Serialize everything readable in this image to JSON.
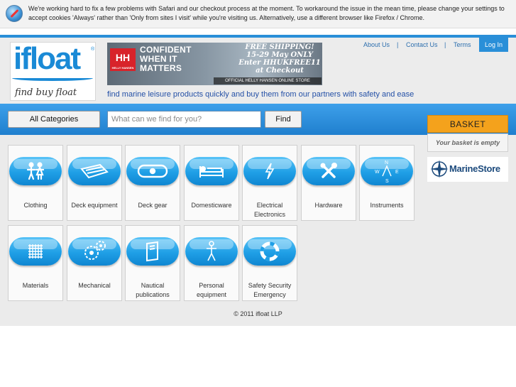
{
  "notice": {
    "text": "We're working hard to fix a few problems with Safari and our checkout process at the moment. To workaround the issue in the mean time, please change your settings to accept cookies 'Always' rather than 'Only from sites I visit' while you're visiting us. Alternatively, use a different browser like Firefox / Chrome.",
    "icon": "safari-compass-icon"
  },
  "brand": {
    "logo_text": "ifloat",
    "logo_registered": "®",
    "logo_tagline": "find buy float",
    "tagline": "find marine leisure products quickly and buy them from our partners with safety and ease",
    "accent": "#2a8fd8"
  },
  "banner": {
    "badge": "HH",
    "badge_sub": "HELLY HANSEN",
    "headline": "CONFIDENT WHEN IT MATTERS",
    "promo": "FREE SHIPPING! 15-29 May ONLY Enter HHUKFREE11 at Checkout",
    "footer": "OFFICIAL HELLY HANSEN ONLINE STORE"
  },
  "nav": {
    "about": "About Us",
    "contact": "Contact Us",
    "terms": "Terms",
    "separator": "|",
    "login": "Log In"
  },
  "search": {
    "category_label": "All Categories",
    "placeholder": "What can we find for you?",
    "find_label": "Find"
  },
  "categories": [
    {
      "label": "Clothing",
      "icon": "people-icon"
    },
    {
      "label": "Deck equipment",
      "icon": "dinghy-icon"
    },
    {
      "label": "Deck gear",
      "icon": "chain-icon"
    },
    {
      "label": "Domesticware",
      "icon": "bed-icon"
    },
    {
      "label": "Electrical Electronics",
      "icon": "lightning-icon"
    },
    {
      "label": "Hardware",
      "icon": "tools-icon"
    },
    {
      "label": "Instruments",
      "icon": "compass-icon"
    },
    {
      "label": "Materials",
      "icon": "fabric-icon"
    },
    {
      "label": "Mechanical",
      "icon": "gears-icon"
    },
    {
      "label": "Nautical publications",
      "icon": "book-icon"
    },
    {
      "label": "Personal equipment",
      "icon": "person-icon"
    },
    {
      "label": "Safety Security Emergency",
      "icon": "lifebuoy-icon"
    }
  ],
  "basket": {
    "title": "BASKET",
    "empty_text": "Your basket is empty",
    "accent": "#f4a21c"
  },
  "partner": {
    "name": "MarineStore"
  },
  "footer": {
    "copyright": "© 2011 ifloat LLP"
  }
}
